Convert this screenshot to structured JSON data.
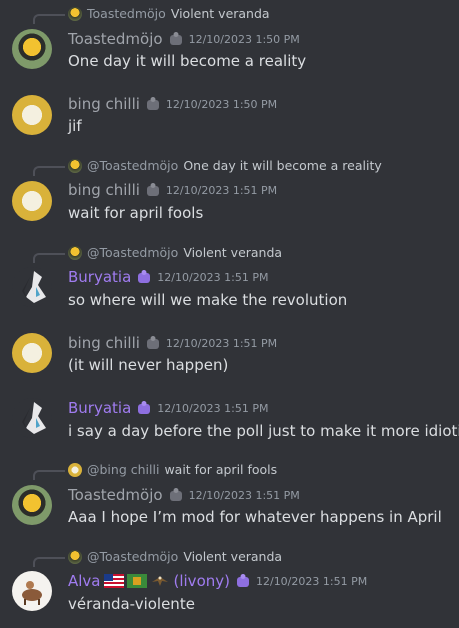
{
  "messages": [
    {
      "reply": {
        "name": "Toastedmöjo",
        "text": "Violent veranda"
      },
      "author": "Toastedmöjo",
      "timestamp": "12/10/2023 1:50 PM",
      "text": "One day it will become a reality"
    },
    {
      "author": "bing chilli",
      "timestamp": "12/10/2023 1:50 PM",
      "text": "jif"
    },
    {
      "reply": {
        "name": "@Toastedmöjo",
        "text": "One day it will become a reality"
      },
      "author": "bing chilli",
      "timestamp": "12/10/2023 1:51 PM",
      "text": "wait for april fools"
    },
    {
      "reply": {
        "name": "@Toastedmöjo",
        "text": "Violent veranda"
      },
      "author": "Buryatia",
      "timestamp": "12/10/2023 1:51 PM",
      "text": "so where will we make the revolution"
    },
    {
      "author": "bing chilli",
      "timestamp": "12/10/2023 1:51 PM",
      "text": "(it will never happen)"
    },
    {
      "author": "Buryatia",
      "timestamp": "12/10/2023 1:51 PM",
      "text": "i say a day before the poll just to make it more idiotic"
    },
    {
      "reply": {
        "name": "@bing chilli",
        "text": "wait for april fools"
      },
      "author": "Toastedmöjo",
      "timestamp": "12/10/2023 1:51 PM",
      "text": "Aaa I hope I’m mod for whatever happens in April"
    },
    {
      "reply": {
        "name": "@Toastedmöjo",
        "text": "Violent veranda"
      },
      "author": "Alva",
      "author_suffix": "(livony)",
      "timestamp": "12/10/2023 1:51 PM",
      "text": "véranda-violente"
    }
  ],
  "colors": {
    "background": "#313338",
    "username_gray": "#a0a4ab",
    "username_purple": "#a07cf0",
    "timestamp": "#949ba4",
    "text": "#dbdee1"
  }
}
